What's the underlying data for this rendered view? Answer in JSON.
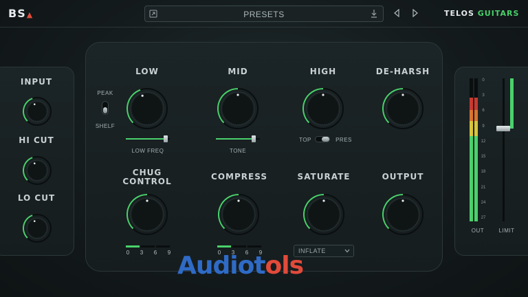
{
  "header": {
    "brand": "BS",
    "presets_label": "PRESETS",
    "logo_part1": "TELOS",
    "logo_part2": "GUITARS"
  },
  "left": {
    "input_label": "INPUT",
    "hicut_label": "HI CUT",
    "locut_label": "LO CUT"
  },
  "main": {
    "low_label": "LOW",
    "mid_label": "MID",
    "high_label": "HIGH",
    "deharsh_label": "DE-HARSH",
    "peak_label": "PEAK",
    "shelf_label": "SHELF",
    "low_freq_label": "LOW FREQ",
    "tone_label": "TONE",
    "top_label": "TOP",
    "pres_label": "PRES",
    "chug_label_1": "CHUG",
    "chug_label_2": "CONTROL",
    "compress_label": "COMPRESS",
    "saturate_label": "SATURATE",
    "output_label": "OUTPUT",
    "step_ticks": [
      "0",
      "3",
      "6",
      "9"
    ],
    "chug_step": 1,
    "compress_step": 1,
    "saturate_mode": "INFLATE",
    "low_freq_value": 0.95,
    "tone_value": 0.9
  },
  "meters": {
    "scale": [
      "0",
      "3",
      "6",
      "9",
      "12",
      "15",
      "18",
      "21",
      "24",
      "27"
    ],
    "out_label": "OUT",
    "limit_label": "LIMIT",
    "limit_value": 0.35
  },
  "watermark": {
    "part1": "Audiot",
    "part2": "ols"
  },
  "colors": {
    "accent": "#4ad16b",
    "meter_red": "#c93a2e",
    "meter_yellow": "#d9c53a"
  }
}
